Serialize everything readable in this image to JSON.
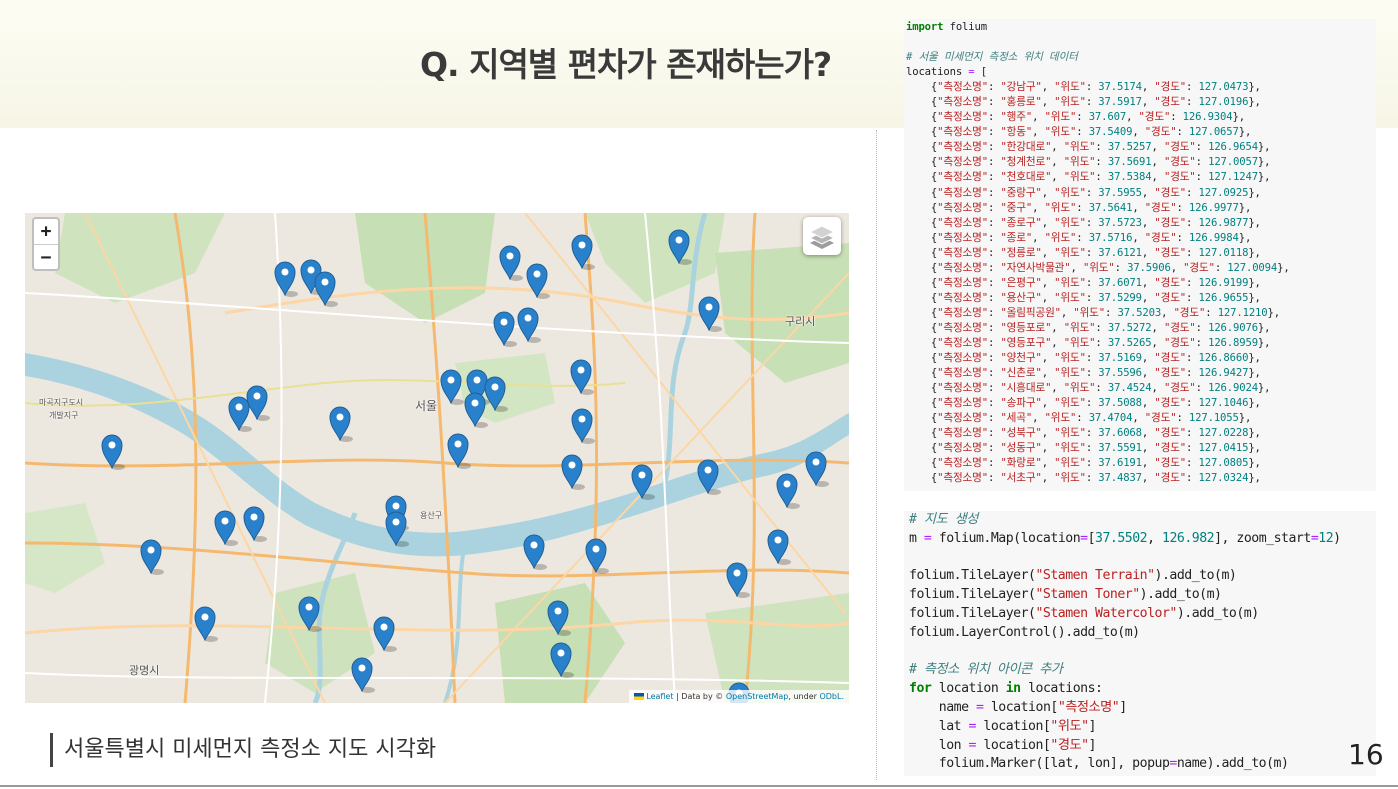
{
  "slide": {
    "title": "Q. 지역별 편차가 존재하는가?",
    "caption": "서울특별시 미세먼지 측정소 지도 시각화",
    "page_number": "16"
  },
  "map": {
    "zoom_in_label": "+",
    "zoom_out_label": "−",
    "attribution": {
      "leaflet": "Leaflet",
      "data_by": " | Data by © ",
      "osm": "OpenStreetMap",
      "under": ", under ",
      "odbl": "ODbL."
    },
    "place_labels": {
      "seoul": "서울",
      "guri": "구리시",
      "gwangmyeong": "광명시",
      "magok_line1": "마곡지구도시",
      "magok_line2": "개발지구",
      "yongsan": "용산구"
    },
    "marker_color": "#2a81cb",
    "river_color": "#aad3df"
  },
  "code_top": [
    "import folium",
    "",
    "# 서울 미세먼지 측정소 위치 데이터",
    "locations = [",
    "    {\"측정소명\": \"강남구\", \"위도\": 37.5174, \"경도\": 127.0473},",
    "    {\"측정소명\": \"홍릉로\", \"위도\": 37.5917, \"경도\": 127.0196},",
    "    {\"측정소명\": \"행주\", \"위도\": 37.607, \"경도\": 126.9304},",
    "    {\"측정소명\": \"항동\", \"위도\": 37.5409, \"경도\": 127.0657},",
    "    {\"측정소명\": \"한강대로\", \"위도\": 37.5257, \"경도\": 126.9654},",
    "    {\"측정소명\": \"청계천로\", \"위도\": 37.5691, \"경도\": 127.0057},",
    "    {\"측정소명\": \"천호대로\", \"위도\": 37.5384, \"경도\": 127.1247},",
    "    {\"측정소명\": \"중랑구\", \"위도\": 37.5955, \"경도\": 127.0925},",
    "    {\"측정소명\": \"중구\", \"위도\": 37.5641, \"경도\": 126.9977},",
    "    {\"측정소명\": \"종로구\", \"위도\": 37.5723, \"경도\": 126.9877},",
    "    {\"측정소명\": \"종로\", \"위도\": 37.5716, \"경도\": 126.9984},",
    "    {\"측정소명\": \"정릉로\", \"위도\": 37.6121, \"경도\": 127.0118},",
    "    {\"측정소명\": \"자연사박물관\", \"위도\": 37.5906, \"경도\": 127.0094},",
    "    {\"측정소명\": \"은평구\", \"위도\": 37.6071, \"경도\": 126.9199},",
    "    {\"측정소명\": \"용산구\", \"위도\": 37.5299, \"경도\": 126.9655},",
    "    {\"측정소명\": \"올림픽공원\", \"위도\": 37.5203, \"경도\": 127.1210},",
    "    {\"측정소명\": \"영등포로\", \"위도\": 37.5272, \"경도\": 126.9076},",
    "    {\"측정소명\": \"영등포구\", \"위도\": 37.5265, \"경도\": 126.8959},",
    "    {\"측정소명\": \"양천구\", \"위도\": 37.5169, \"경도\": 126.8660},",
    "    {\"측정소명\": \"신촌로\", \"위도\": 37.5596, \"경도\": 126.9427},",
    "    {\"측정소명\": \"시흥대로\", \"위도\": 37.4524, \"경도\": 126.9024},",
    "    {\"측정소명\": \"송파구\", \"위도\": 37.5088, \"경도\": 127.1046},",
    "    {\"측정소명\": \"세곡\", \"위도\": 37.4704, \"경도\": 127.1055},",
    "    {\"측정소명\": \"성북구\", \"위도\": 37.6068, \"경도\": 127.0228},",
    "    {\"측정소명\": \"성동구\", \"위도\": 37.5591, \"경도\": 127.0415},",
    "    {\"측정소명\": \"화랑로\", \"위도\": 37.6191, \"경도\": 127.0805},",
    "    {\"측정소명\": \"서초구\", \"위도\": 37.4837, \"경도\": 127.0324},"
  ],
  "code_bottom": [
    "# 지도 생성",
    "m = folium.Map(location=[37.5502, 126.982], zoom_start=12)",
    "",
    "folium.TileLayer(\"Stamen Terrain\").add_to(m)",
    "folium.TileLayer(\"Stamen Toner\").add_to(m)",
    "folium.TileLayer(\"Stamen Watercolor\").add_to(m)",
    "folium.LayerControl().add_to(m)",
    "",
    "# 측정소 위치 아이콘 추가",
    "for location in locations:",
    "    name = location[\"측정소명\"]",
    "    lat = location[\"위도\"]",
    "    lon = location[\"경도\"]",
    "    folium.Marker([lat, lon], popup=name).add_to(m)"
  ]
}
